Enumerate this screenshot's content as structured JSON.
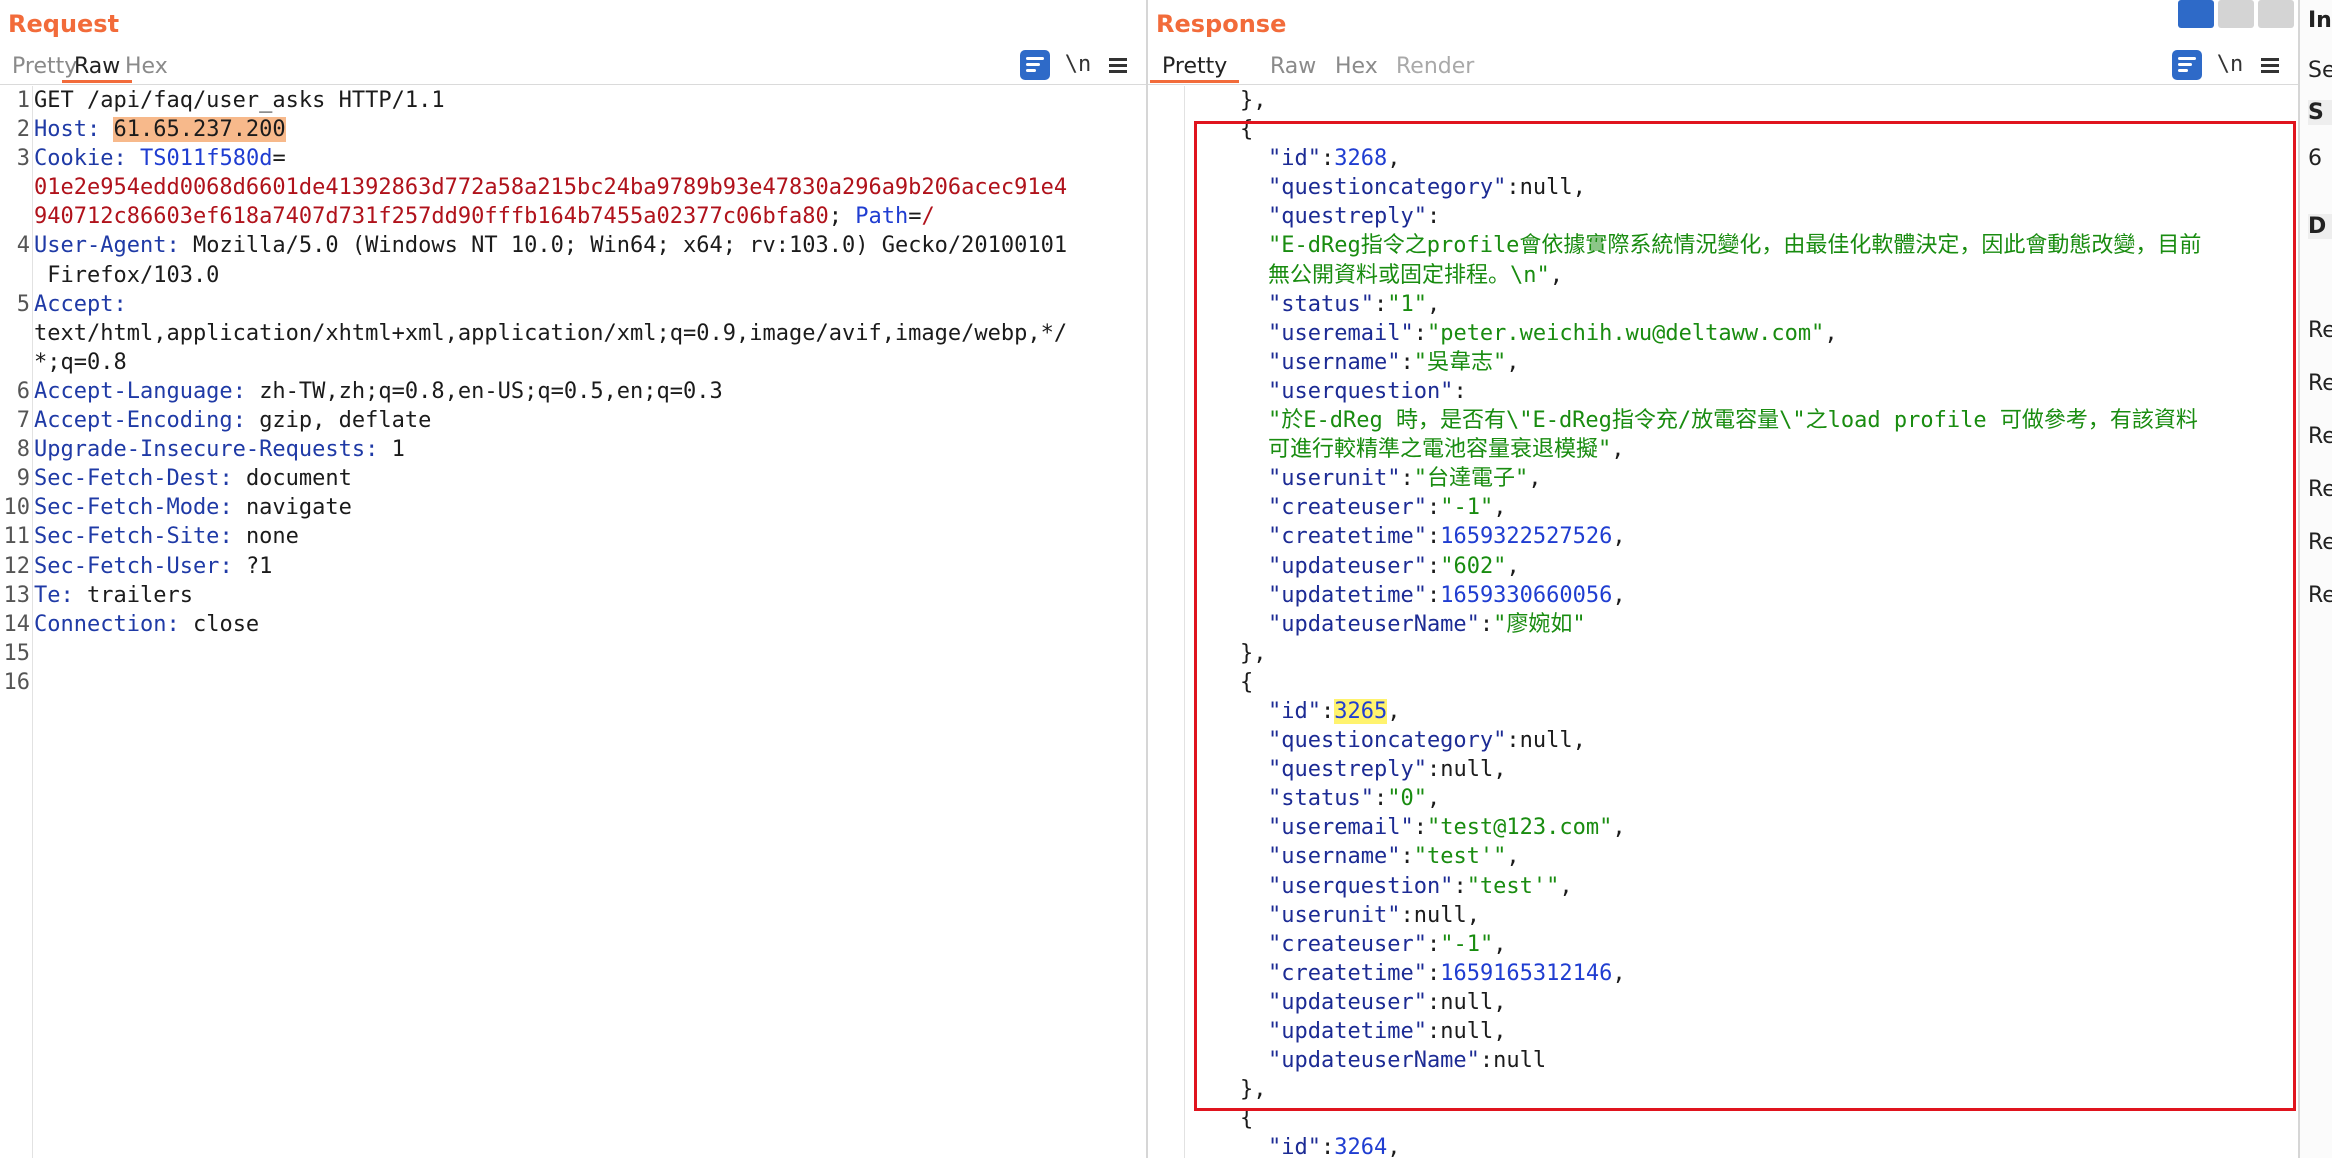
{
  "request": {
    "title": "Request",
    "tabs": [
      "Pretty",
      "Raw",
      "Hex"
    ],
    "active_tab": "Raw",
    "toolbar": {
      "newline_label": "\\n"
    },
    "line_numbers": [
      "1",
      "2",
      "3",
      "4",
      "5",
      "6",
      "7",
      "8",
      "9",
      "10",
      "11",
      "12",
      "13",
      "14",
      "15",
      "16"
    ],
    "lines": {
      "request_line": "GET /api/faq/user_asks HTTP/1.1",
      "host_name": "Host",
      "host_value": "61.65.237.200",
      "cookie_name": "Cookie",
      "cookie_key": "TS011f580d",
      "cookie_val_1": "01e2e954edd0068d6601de41392863d772a58a215bc24ba9789b93e47830a296a9b206acec91e4",
      "cookie_val_2": "940712c86603ef618a7407d731f257dd90fffb164b7455a02377c06bfa80",
      "cookie_path_name": "Path",
      "cookie_path_val": "/",
      "ua_name": "User-Agent",
      "ua_value": "Mozilla/5.0 (Windows NT 10.0; Win64; x64; rv:103.0) Gecko/20100101",
      "ua_cont": " Firefox/103.0",
      "accept_name": "Accept",
      "accept_val_1": "text/html,application/xhtml+xml,application/xml;q=0.9,image/avif,image/webp,*/",
      "accept_val_2": "*;q=0.8",
      "lang_name": "Accept-Language",
      "lang_value": "zh-TW,zh;q=0.8,en-US;q=0.5,en;q=0.3",
      "enc_name": "Accept-Encoding",
      "enc_value": "gzip, deflate",
      "uir_name": "Upgrade-Insecure-Requests",
      "uir_value": "1",
      "sfd_name": "Sec-Fetch-Dest",
      "sfd_value": "document",
      "sfm_name": "Sec-Fetch-Mode",
      "sfm_value": "navigate",
      "sfs_name": "Sec-Fetch-Site",
      "sfs_value": "none",
      "sfu_name": "Sec-Fetch-User",
      "sfu_value": "?1",
      "te_name": "Te",
      "te_value": "trailers",
      "conn_name": "Connection",
      "conn_value": "close"
    }
  },
  "response": {
    "title": "Response",
    "tabs": [
      "Pretty",
      "Raw",
      "Hex",
      "Render"
    ],
    "active_tab": "Pretty",
    "toolbar": {
      "newline_label": "\\n"
    },
    "record1": {
      "id": "3268",
      "questioncategory": "null",
      "questreply_1": "\"E-dReg指令之profile會依據實際系統情況變化，由最佳化軟體決定，因此會動態改變，目前",
      "questreply_2": "無公開資料或固定排程。\\n\"",
      "status": "\"1\"",
      "useremail": "\"peter.weichih.wu@deltaww.com\"",
      "username": "\"吳韋志\"",
      "userquestion_1": "\"於E-dReg 時，是否有\\\"E-dReg指令充/放電容量\\\"之load profile 可做參考，有該資料",
      "userquestion_2": "可進行較精準之電池容量衰退模擬\"",
      "userunit": "\"台達電子\"",
      "createuser": "\"-1\"",
      "createtime": "1659322527526",
      "updateuser": "\"602\"",
      "updatetime": "1659330660056",
      "updateuserName": "\"廖婉如\""
    },
    "record2": {
      "id": "3265",
      "questioncategory": "null",
      "questreply": "null",
      "status": "\"0\"",
      "useremail": "\"test@123.com\"",
      "username": "\"test'\"",
      "userquestion": "\"test'\"",
      "userunit": "null",
      "createuser": "\"-1\"",
      "createtime": "1659165312146",
      "updateuser": "null",
      "updatetime": "null",
      "updateuserName": "null"
    },
    "record3": {
      "id": "3264"
    }
  },
  "inspector": {
    "title_fragment": "In",
    "items": [
      "Se",
      "S",
      "6",
      "D",
      "Re",
      "Re",
      "Re",
      "Re",
      "Re",
      "Re"
    ]
  },
  "colors": {
    "accent": "#f26b3a",
    "highlight_box": "#e0141e",
    "json_key": "#1c2b94",
    "json_string": "#198c10",
    "json_number": "#1f3dd1",
    "header_name": "#1f3aa6",
    "cookie_value": "#b0121b"
  },
  "icons": [
    "wrap-lines-icon",
    "menu-icon",
    "layout-split-icon",
    "layout-rows-icon",
    "layout-single-icon"
  ]
}
